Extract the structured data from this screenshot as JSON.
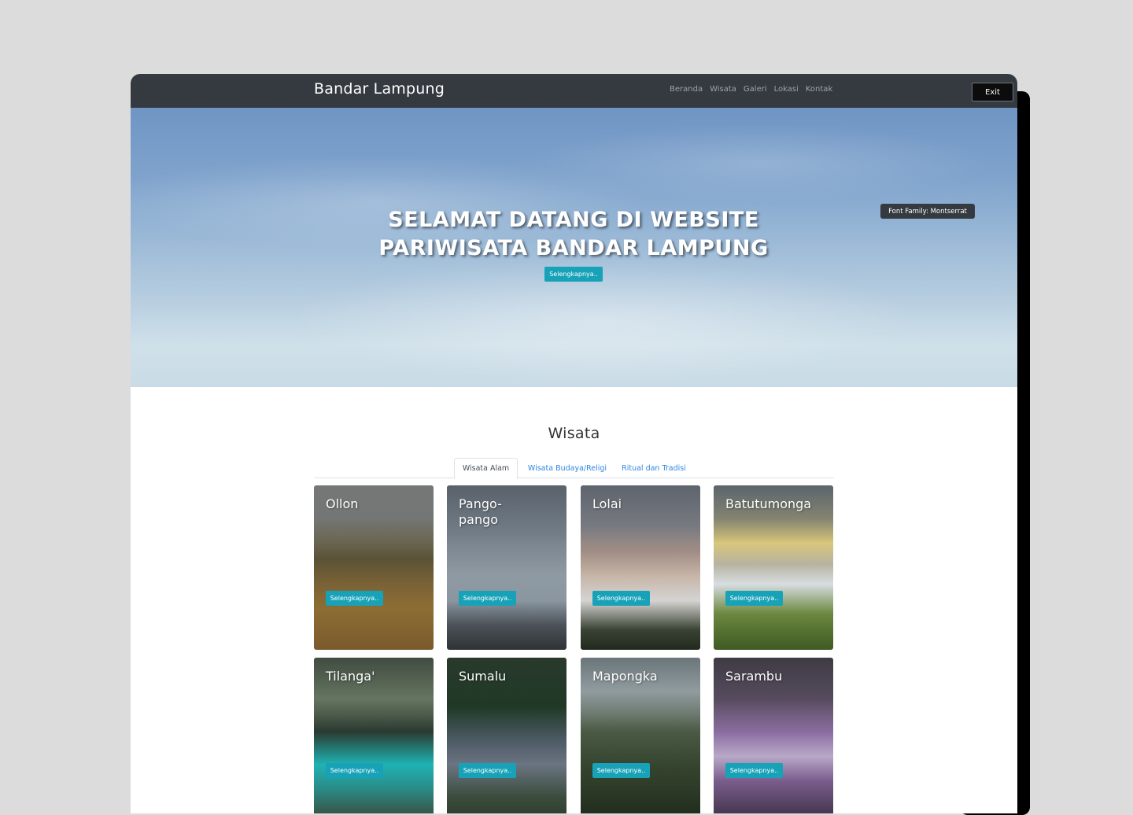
{
  "navbar": {
    "brand": "Bandar Lampung",
    "links": [
      "Beranda",
      "Wisata",
      "Galeri",
      "Lokasi",
      "Kontak"
    ],
    "exit_label": "Exit"
  },
  "hero": {
    "title": "SELAMAT DATANG DI WEBSITE PARIWISATA BANDAR LAMPUNG",
    "button_label": "Selengkapnya..",
    "font_badge": "Font Family: Montserrat"
  },
  "section": {
    "title": "Wisata",
    "tabs": [
      "Wisata Alam",
      "Wisata Budaya/Religi",
      "Ritual dan Tradisi"
    ]
  },
  "cards": [
    {
      "title": "Ollon",
      "button": "Selengkapnya.."
    },
    {
      "title": "Pango-pango",
      "button": "Selengkapnya.."
    },
    {
      "title": "Lolai",
      "button": "Selengkapnya.."
    },
    {
      "title": "Batutumonga",
      "button": "Selengkapnya.."
    },
    {
      "title": "Tilanga'",
      "button": "Selengkapnya.."
    },
    {
      "title": "Sumalu",
      "button": "Selengkapnya.."
    },
    {
      "title": "Mapongka",
      "button": "Selengkapnya.."
    },
    {
      "title": "Sarambu",
      "button": "Selengkapnya.."
    }
  ],
  "colors": {
    "navbar": "#343a40",
    "accent": "#17a2b8",
    "link": "#2f86e0"
  }
}
